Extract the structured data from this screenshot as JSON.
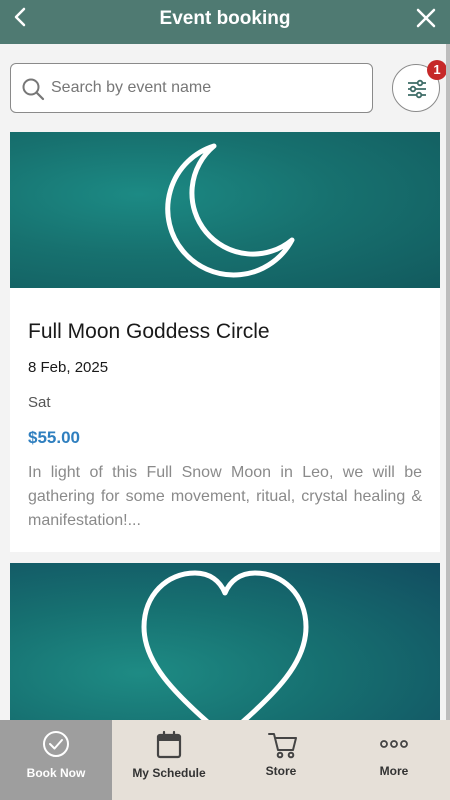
{
  "header": {
    "title": "Event booking",
    "back_icon": "chevron-left-icon",
    "close_icon": "close-icon"
  },
  "search": {
    "placeholder": "Search by event name",
    "value": "",
    "icon": "search-icon"
  },
  "filter": {
    "icon": "sliders-icon",
    "badge_count": "1"
  },
  "events": [
    {
      "title": "Full Moon Goddess Circle",
      "date": "8 Feb, 2025",
      "day": "Sat",
      "price": "$55.00",
      "description": "In light of this Full Snow Moon in Leo, we will be gathering for some movement, ritual, crystal healing & manifestation!...",
      "image_icon": "crescent-moon-icon"
    },
    {
      "image_icon": "heart-icon"
    }
  ],
  "nav": [
    {
      "label": "Book Now",
      "icon": "check-circle-icon",
      "active": true
    },
    {
      "label": "My Schedule",
      "icon": "calendar-icon",
      "active": false
    },
    {
      "label": "Store",
      "icon": "cart-icon",
      "active": false
    },
    {
      "label": "More",
      "icon": "more-dots-icon",
      "active": false
    }
  ],
  "colors": {
    "header": "#4f7a72",
    "price": "#2f7fbf",
    "badge": "#c62828",
    "nav_bg": "#e6e0d8",
    "nav_active": "#9e9e9e"
  }
}
